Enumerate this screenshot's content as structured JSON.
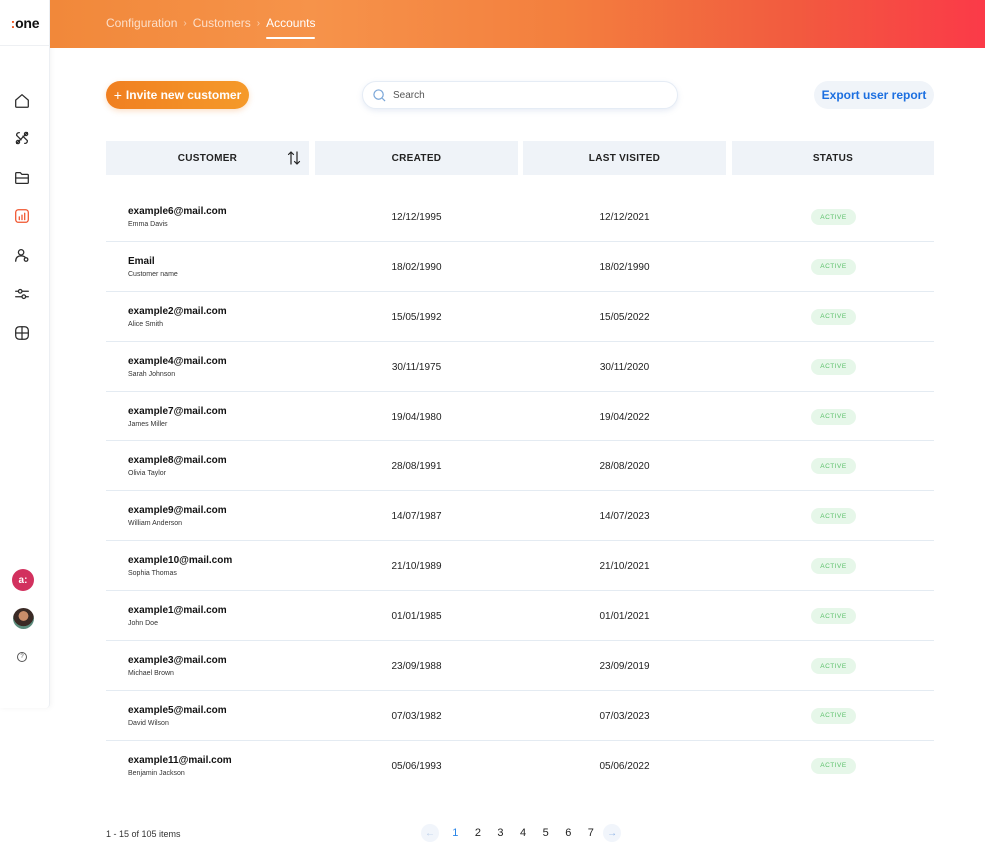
{
  "app": {
    "logo_dots": ":",
    "logo_text": "one"
  },
  "breadcrumb": {
    "items": [
      "Configuration",
      "Customers"
    ],
    "current": "Accounts",
    "separator": "›"
  },
  "toolbar": {
    "invite_plus": "+",
    "invite_label": "Invite new customer",
    "search_placeholder": "Search",
    "export_label": "Export user report"
  },
  "sidebar": {
    "active_item": "reports-icon",
    "icons": [
      "home-icon",
      "tools-icon",
      "folder-icon",
      "reports-icon",
      "users-icon",
      "sliders-icon",
      "integrations-icon"
    ],
    "brand_badge": "a:"
  },
  "table": {
    "headers": {
      "customer": "CUSTOMER",
      "created": "CREATED",
      "last_visited": "LAST VISITED",
      "status": "STATUS"
    },
    "rows": [
      {
        "email": "example6@mail.com",
        "name": "Emma Davis",
        "created": "12/12/1995",
        "last_visited": "12/12/2021",
        "status": "ACTIVE"
      },
      {
        "email": "Email",
        "name": "Customer name",
        "created": "18/02/1990",
        "last_visited": "18/02/1990",
        "status": "ACTIVE"
      },
      {
        "email": "example2@mail.com",
        "name": "Alice Smith",
        "created": "15/05/1992",
        "last_visited": "15/05/2022",
        "status": "ACTIVE"
      },
      {
        "email": "example4@mail.com",
        "name": "Sarah Johnson",
        "created": "30/11/1975",
        "last_visited": "30/11/2020",
        "status": "ACTIVE"
      },
      {
        "email": "example7@mail.com",
        "name": "James Miller",
        "created": "19/04/1980",
        "last_visited": "19/04/2022",
        "status": "ACTIVE"
      },
      {
        "email": "example8@mail.com",
        "name": "Olivia Taylor",
        "created": "28/08/1991",
        "last_visited": "28/08/2020",
        "status": "ACTIVE"
      },
      {
        "email": "example9@mail.com",
        "name": "William Anderson",
        "created": "14/07/1987",
        "last_visited": "14/07/2023",
        "status": "ACTIVE"
      },
      {
        "email": "example10@mail.com",
        "name": "Sophia Thomas",
        "created": "21/10/1989",
        "last_visited": "21/10/2021",
        "status": "ACTIVE"
      },
      {
        "email": "example1@mail.com",
        "name": "John Doe",
        "created": "01/01/1985",
        "last_visited": "01/01/2021",
        "status": "ACTIVE"
      },
      {
        "email": "example3@mail.com",
        "name": "Michael Brown",
        "created": "23/09/1988",
        "last_visited": "23/09/2019",
        "status": "ACTIVE"
      },
      {
        "email": "example5@mail.com",
        "name": "David Wilson",
        "created": "07/03/1982",
        "last_visited": "07/03/2023",
        "status": "ACTIVE"
      },
      {
        "email": "example11@mail.com",
        "name": "Benjamin Jackson",
        "created": "05/06/1993",
        "last_visited": "05/06/2022",
        "status": "ACTIVE"
      }
    ]
  },
  "footer": {
    "items_count": "1 - 15 of 105 items",
    "prev_arrow": "←",
    "next_arrow": "→",
    "pages": [
      "1",
      "2",
      "3",
      "4",
      "5",
      "6",
      "7"
    ],
    "current_page": "1"
  },
  "colors": {
    "accent_orange": "#f07f20",
    "header_gradient_end": "#fb3a48",
    "link_blue": "#1c6fe0",
    "status_green": "#5cc06a",
    "status_green_bg": "#e6f7e9"
  }
}
